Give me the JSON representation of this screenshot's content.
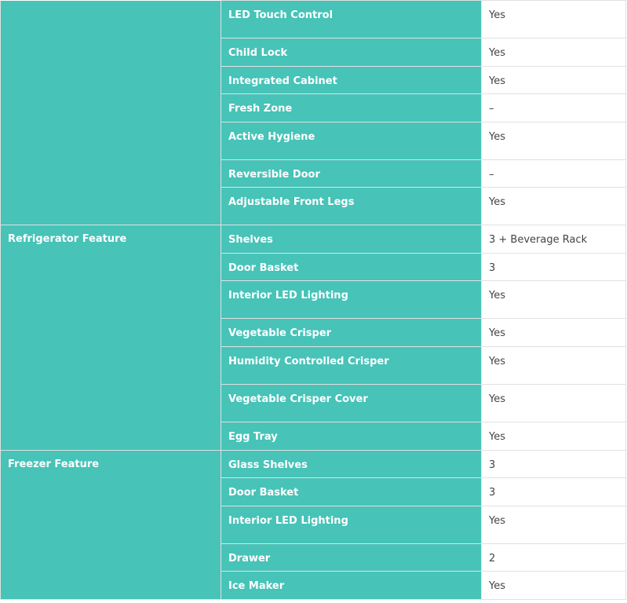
{
  "sections": [
    {
      "category": "",
      "rows": [
        {
          "feature": "LED Touch Control",
          "value": "Yes"
        },
        {
          "feature": "Child Lock",
          "value": "Yes"
        },
        {
          "feature": "Integrated Cabinet",
          "value": "Yes"
        },
        {
          "feature": "Fresh Zone",
          "value": "–"
        },
        {
          "feature": "Active Hygiene",
          "value": "Yes"
        },
        {
          "feature": "Reversible Door",
          "value": "–"
        },
        {
          "feature": "Adjustable Front Legs",
          "value": "Yes"
        }
      ]
    },
    {
      "category": "Refrigerator Feature",
      "rows": [
        {
          "feature": "Shelves",
          "value": "3 + Beverage Rack"
        },
        {
          "feature": "Door Basket",
          "value": "3"
        },
        {
          "feature": "Interior LED Lighting",
          "value": "Yes"
        },
        {
          "feature": "Vegetable Crisper",
          "value": "Yes"
        },
        {
          "feature": "Humidity Controlled Crisper",
          "value": "Yes"
        },
        {
          "feature": "Vegetable Crisper Cover",
          "value": "Yes"
        },
        {
          "feature": "Egg Tray",
          "value": "Yes"
        }
      ]
    },
    {
      "category": "Freezer Feature",
      "rows": [
        {
          "feature": "Glass Shelves",
          "value": "3"
        },
        {
          "feature": "Door Basket",
          "value": "3"
        },
        {
          "feature": "Interior LED Lighting",
          "value": "Yes"
        },
        {
          "feature": "Drawer",
          "value": "2"
        },
        {
          "feature": "Ice Maker",
          "value": "Yes"
        }
      ]
    }
  ],
  "colors": {
    "header_bg": "#47c3b8",
    "value_bg": "#ffffff",
    "border": "#e1e1e1"
  }
}
